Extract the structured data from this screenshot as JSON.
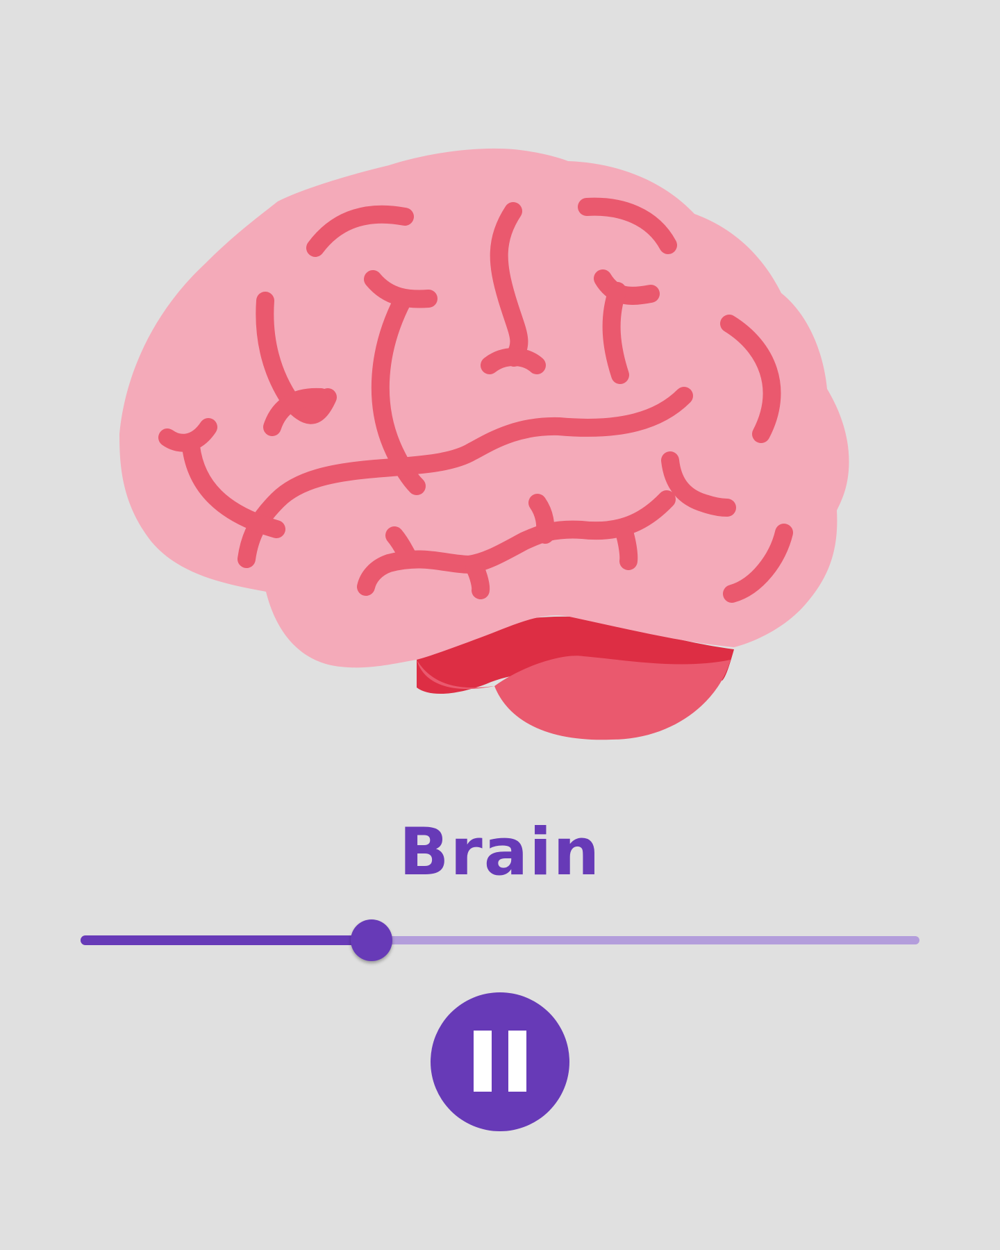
{
  "illustration": {
    "icon": "brain-icon",
    "colors": {
      "brain_fill": "#f4aab9",
      "folds": "#ea596e",
      "cerebellum": "#ea596e",
      "cerebellum_shadow": "#dd2e44"
    }
  },
  "title": {
    "text": "Brain",
    "color": "#673ab7"
  },
  "seek_slider": {
    "progress": 0.347,
    "active_color": "#673ab7",
    "inactive_color": "#b39ddb"
  },
  "playback_button": {
    "icon": "pause-icon",
    "state": "playing",
    "color": "#673ab7"
  }
}
